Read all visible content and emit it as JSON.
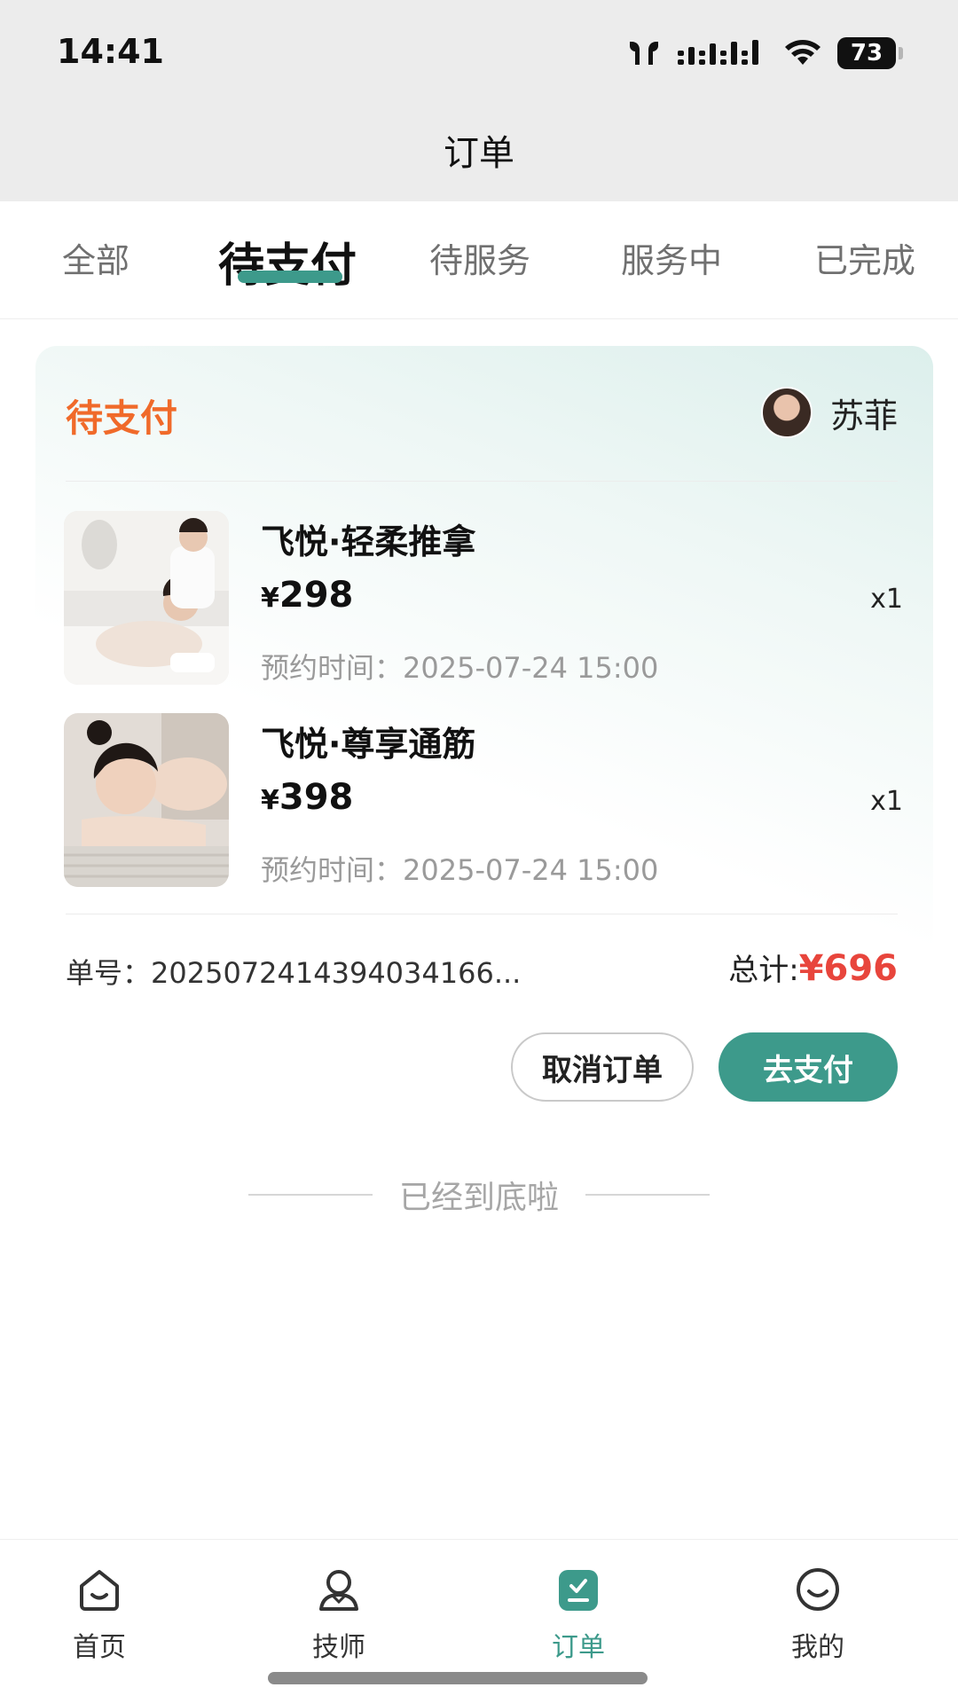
{
  "status_bar": {
    "time": "14:41",
    "battery": "73"
  },
  "header": {
    "title": "订单"
  },
  "tabs": [
    {
      "label": "全部"
    },
    {
      "label": "待支付"
    },
    {
      "label": "待服务"
    },
    {
      "label": "服务中"
    },
    {
      "label": "已完成"
    }
  ],
  "order": {
    "status": "待支付",
    "technician": {
      "name": "苏菲"
    },
    "items": [
      {
        "name": "飞悦·轻柔推拿",
        "currency": "¥",
        "price": "298",
        "qty": "x1",
        "time": "预约时间：2025-07-24 15:00"
      },
      {
        "name": "飞悦·尊享通筋",
        "currency": "¥",
        "price": "398",
        "qty": "x1",
        "time": "预约时间：2025-07-24 15:00"
      }
    ],
    "order_no": "单号：2025072414394034166...",
    "total_label": "总计:",
    "total_amount": "¥696",
    "cancel_label": "取消订单",
    "pay_label": "去支付"
  },
  "end_text": "已经到底啦",
  "bottom_nav": [
    {
      "label": "首页",
      "icon": "home-icon"
    },
    {
      "label": "技师",
      "icon": "technician-icon"
    },
    {
      "label": "订单",
      "icon": "order-icon"
    },
    {
      "label": "我的",
      "icon": "profile-icon"
    }
  ],
  "colors": {
    "accent": "#3d9a8b",
    "status_orange": "#f06a2a",
    "total_red": "#e8453c"
  }
}
